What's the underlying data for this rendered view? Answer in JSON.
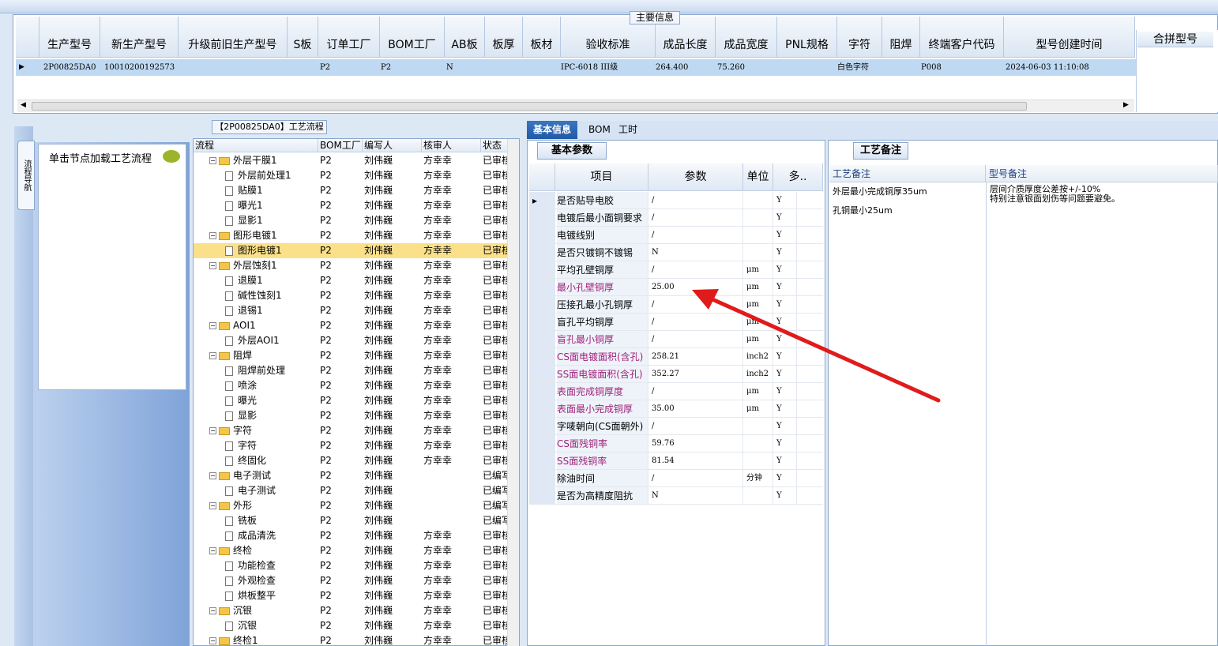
{
  "main": {
    "title": "主要信息",
    "headers": [
      "生产型号",
      "新生产型号",
      "升级前旧生产型号",
      "S板",
      "订单工厂",
      "BOM工厂",
      "AB板",
      "板厚",
      "板材",
      "验收标准",
      "成品长度",
      "成品宽度",
      "PNL规格",
      "字符",
      "阻焊",
      "终端客户代码",
      "型号创建时间"
    ],
    "extra_header": "合拼型号",
    "row": {
      "model": "2P00825DA0",
      "new_model": "10010200192573",
      "order_factory": "P2",
      "bom_factory": "P2",
      "ab": "N",
      "standard": "IPC-6018 III级",
      "length": "264.400",
      "width": "75.260",
      "char": "白色字符",
      "customer": "P008",
      "created": "2024-06-03 11:10:08"
    }
  },
  "left": {
    "tab_label": "流程导航",
    "hint": "单击节点加载工艺流程"
  },
  "process": {
    "title": "【2P00825DA0】工艺流程",
    "headers": [
      "流程",
      "BOM工厂",
      "编写人",
      "核审人",
      "状态"
    ],
    "rows": [
      {
        "name": "外层干膜1",
        "level": 0,
        "bom": "P2",
        "writer": "刘伟巍",
        "reviewer": "方幸幸",
        "status": "已审核"
      },
      {
        "name": "外层前处理1",
        "level": 1,
        "bom": "P2",
        "writer": "刘伟巍",
        "reviewer": "方幸幸",
        "status": "已审核"
      },
      {
        "name": "贴膜1",
        "level": 1,
        "bom": "P2",
        "writer": "刘伟巍",
        "reviewer": "方幸幸",
        "status": "已审核"
      },
      {
        "name": "曝光1",
        "level": 1,
        "bom": "P2",
        "writer": "刘伟巍",
        "reviewer": "方幸幸",
        "status": "已审核"
      },
      {
        "name": "显影1",
        "level": 1,
        "bom": "P2",
        "writer": "刘伟巍",
        "reviewer": "方幸幸",
        "status": "已审核"
      },
      {
        "name": "图形电镀1",
        "level": 0,
        "bom": "P2",
        "writer": "刘伟巍",
        "reviewer": "方幸幸",
        "status": "已审核"
      },
      {
        "name": "图形电镀1",
        "level": 1,
        "bom": "P2",
        "writer": "刘伟巍",
        "reviewer": "方幸幸",
        "status": "已审核",
        "selected": true
      },
      {
        "name": "外层蚀刻1",
        "level": 0,
        "bom": "P2",
        "writer": "刘伟巍",
        "reviewer": "方幸幸",
        "status": "已审核"
      },
      {
        "name": "退膜1",
        "level": 1,
        "bom": "P2",
        "writer": "刘伟巍",
        "reviewer": "方幸幸",
        "status": "已审核"
      },
      {
        "name": "碱性蚀刻1",
        "level": 1,
        "bom": "P2",
        "writer": "刘伟巍",
        "reviewer": "方幸幸",
        "status": "已审核"
      },
      {
        "name": "退锡1",
        "level": 1,
        "bom": "P2",
        "writer": "刘伟巍",
        "reviewer": "方幸幸",
        "status": "已审核"
      },
      {
        "name": "AOI1",
        "level": 0,
        "bom": "P2",
        "writer": "刘伟巍",
        "reviewer": "方幸幸",
        "status": "已审核"
      },
      {
        "name": "外层AOI1",
        "level": 1,
        "bom": "P2",
        "writer": "刘伟巍",
        "reviewer": "方幸幸",
        "status": "已审核"
      },
      {
        "name": "阻焊",
        "level": 0,
        "bom": "P2",
        "writer": "刘伟巍",
        "reviewer": "方幸幸",
        "status": "已审核"
      },
      {
        "name": "阻焊前处理",
        "level": 1,
        "bom": "P2",
        "writer": "刘伟巍",
        "reviewer": "方幸幸",
        "status": "已审核"
      },
      {
        "name": "喷涂",
        "level": 1,
        "bom": "P2",
        "writer": "刘伟巍",
        "reviewer": "方幸幸",
        "status": "已审核"
      },
      {
        "name": "曝光",
        "level": 1,
        "bom": "P2",
        "writer": "刘伟巍",
        "reviewer": "方幸幸",
        "status": "已审核"
      },
      {
        "name": "显影",
        "level": 1,
        "bom": "P2",
        "writer": "刘伟巍",
        "reviewer": "方幸幸",
        "status": "已审核"
      },
      {
        "name": "字符",
        "level": 0,
        "bom": "P2",
        "writer": "刘伟巍",
        "reviewer": "方幸幸",
        "status": "已审核"
      },
      {
        "name": "字符",
        "level": 1,
        "bom": "P2",
        "writer": "刘伟巍",
        "reviewer": "方幸幸",
        "status": "已审核"
      },
      {
        "name": "终固化",
        "level": 1,
        "bom": "P2",
        "writer": "刘伟巍",
        "reviewer": "方幸幸",
        "status": "已审核"
      },
      {
        "name": "电子测试",
        "level": 0,
        "bom": "P2",
        "writer": "刘伟巍",
        "reviewer": "",
        "status": "已编写"
      },
      {
        "name": "电子测试",
        "level": 1,
        "bom": "P2",
        "writer": "刘伟巍",
        "reviewer": "",
        "status": "已编写"
      },
      {
        "name": "外形",
        "level": 0,
        "bom": "P2",
        "writer": "刘伟巍",
        "reviewer": "",
        "status": "已编写"
      },
      {
        "name": "铣板",
        "level": 1,
        "bom": "P2",
        "writer": "刘伟巍",
        "reviewer": "",
        "status": "已编写"
      },
      {
        "name": "成品清洗",
        "level": 1,
        "bom": "P2",
        "writer": "刘伟巍",
        "reviewer": "方幸幸",
        "status": "已审核"
      },
      {
        "name": "终检",
        "level": 0,
        "bom": "P2",
        "writer": "刘伟巍",
        "reviewer": "方幸幸",
        "status": "已审核"
      },
      {
        "name": "功能检查",
        "level": 1,
        "bom": "P2",
        "writer": "刘伟巍",
        "reviewer": "方幸幸",
        "status": "已审核"
      },
      {
        "name": "外观检查",
        "level": 1,
        "bom": "P2",
        "writer": "刘伟巍",
        "reviewer": "方幸幸",
        "status": "已审核"
      },
      {
        "name": "烘板整平",
        "level": 1,
        "bom": "P2",
        "writer": "刘伟巍",
        "reviewer": "方幸幸",
        "status": "已审核"
      },
      {
        "name": "沉银",
        "level": 0,
        "bom": "P2",
        "writer": "刘伟巍",
        "reviewer": "方幸幸",
        "status": "已审核"
      },
      {
        "name": "沉银",
        "level": 1,
        "bom": "P2",
        "writer": "刘伟巍",
        "reviewer": "方幸幸",
        "status": "已审核"
      },
      {
        "name": "终检1",
        "level": 0,
        "bom": "P2",
        "writer": "刘伟巍",
        "reviewer": "方幸幸",
        "status": "已审核"
      }
    ]
  },
  "tabs": [
    "基本信息",
    "BOM",
    "工时"
  ],
  "basic": {
    "title": "基本参数",
    "headers": [
      "项目",
      "参数",
      "单位",
      "多.."
    ],
    "rows": [
      {
        "item": "是否贴导电胶",
        "value": "/",
        "unit": "",
        "flag": "Y",
        "hl": false
      },
      {
        "item": "电镀后最小面铜要求",
        "value": "/",
        "unit": "",
        "flag": "Y",
        "hl": false
      },
      {
        "item": "电镀线别",
        "value": "/",
        "unit": "",
        "flag": "Y",
        "hl": false
      },
      {
        "item": "是否只镀铜不镀锡",
        "value": "N",
        "unit": "",
        "flag": "Y",
        "hl": false
      },
      {
        "item": "平均孔壁铜厚",
        "value": "/",
        "unit": "μm",
        "flag": "Y",
        "hl": false
      },
      {
        "item": "最小孔壁铜厚",
        "value": "25.00",
        "unit": "μm",
        "flag": "Y",
        "hl": true
      },
      {
        "item": "压接孔最小孔铜厚",
        "value": "/",
        "unit": "μm",
        "flag": "Y",
        "hl": false
      },
      {
        "item": "盲孔平均铜厚",
        "value": "/",
        "unit": "μm",
        "flag": "Y",
        "hl": false
      },
      {
        "item": "盲孔最小铜厚",
        "value": "/",
        "unit": "μm",
        "flag": "Y",
        "hl": true
      },
      {
        "item": "CS面电镀面积(含孔)",
        "value": "258.21",
        "unit": "inch2",
        "flag": "Y",
        "hl": true
      },
      {
        "item": "SS面电镀面积(含孔)",
        "value": "352.27",
        "unit": "inch2",
        "flag": "Y",
        "hl": true
      },
      {
        "item": "表面完成铜厚度",
        "value": "/",
        "unit": "μm",
        "flag": "Y",
        "hl": true
      },
      {
        "item": "表面最小完成铜厚",
        "value": "35.00",
        "unit": "μm",
        "flag": "Y",
        "hl": true
      },
      {
        "item": "字唛朝向(CS面朝外)",
        "value": "/",
        "unit": "",
        "flag": "Y",
        "hl": false
      },
      {
        "item": "CS面残铜率",
        "value": "59.76",
        "unit": "",
        "flag": "Y",
        "hl": true
      },
      {
        "item": "SS面残铜率",
        "value": "81.54",
        "unit": "",
        "flag": "Y",
        "hl": true
      },
      {
        "item": "除油时间",
        "value": "/",
        "unit": "分钟",
        "flag": "Y",
        "hl": false
      },
      {
        "item": "是否为高精度阻抗",
        "value": "N",
        "unit": "",
        "flag": "Y",
        "hl": false
      }
    ]
  },
  "notes": {
    "title": "工艺备注",
    "headers": [
      "工艺备注",
      "型号备注"
    ],
    "process_note_1": "外层最小完成铜厚35um",
    "process_note_2": "孔铜最小25um",
    "model_note_1": "层间介质厚度公差按+/-10%",
    "model_note_2": "特别注意银面划伤等问题要避免。"
  },
  "colors": {
    "accent": "#1f5aa8",
    "selected_row": "#fbe08a",
    "highlight_text": "#a0227a",
    "arrow": "#e01b1b"
  }
}
